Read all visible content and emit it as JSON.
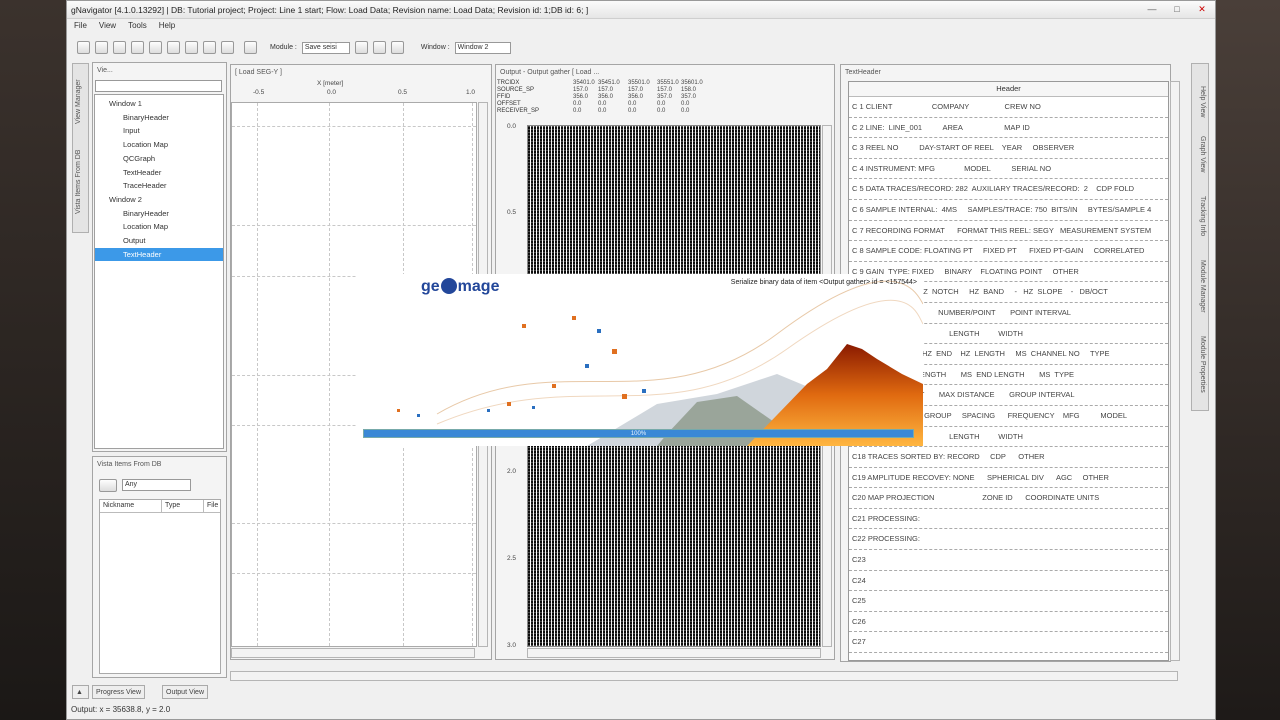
{
  "window": {
    "title": "gNavigator [4.1.0.13292] | DB: Tutorial project; Project: Line 1 start; Flow: Load Data; Revision name: Load Data; Revision id: 1;DB id: 6; ]"
  },
  "menu": [
    "File",
    "View",
    "Tools",
    "Help"
  ],
  "toolbar": {
    "module_label": "Module :",
    "module_value": "Save seisi",
    "window_label": "Window :",
    "window_value": "Window 2"
  },
  "left_panel": {
    "title": "Vie...",
    "tree": [
      {
        "label": "Window 1",
        "level": 0
      },
      {
        "label": "BinaryHeader",
        "level": 1
      },
      {
        "label": "Input",
        "level": 1
      },
      {
        "label": "Location Map",
        "level": 1
      },
      {
        "label": "QCGraph",
        "level": 1
      },
      {
        "label": "TextHeader",
        "level": 1
      },
      {
        "label": "TraceHeader",
        "level": 1
      },
      {
        "label": "Window 2",
        "level": 0
      },
      {
        "label": "BinaryHeader",
        "level": 1
      },
      {
        "label": "Location Map",
        "level": 1
      },
      {
        "label": "Output",
        "level": 1
      },
      {
        "label": "TextHeader",
        "level": 1,
        "selected": true
      }
    ],
    "vista_title": "Vista Items From DB",
    "vista_filter": "Any",
    "vista_columns": [
      "Nickname",
      "Type",
      "File"
    ],
    "side_tabs": [
      "View Manager",
      "Vista Items From DB"
    ]
  },
  "load_panel": {
    "title": "[ Load SEG-Y ]",
    "x_axis_label": "X [meter]",
    "x_ticks": [
      "-0.5",
      "0.0",
      "0.5",
      "1.0"
    ]
  },
  "output_panel": {
    "title": "Output - Output gather [ Load ...",
    "header_names": [
      "TRCIDX",
      "SOURCE_SP",
      "FFID",
      "OFFSET",
      "RECEIVER_SP"
    ],
    "header_cols": [
      [
        "35401.0",
        "157.0",
        "356.0",
        "0.0",
        "0.0"
      ],
      [
        "35451.0",
        "157.0",
        "356.0",
        "0.0",
        "0.0"
      ],
      [
        "35501.0",
        "157.0",
        "356.0",
        "0.0",
        "0.0"
      ],
      [
        "35551.0",
        "157.0",
        "357.0",
        "0.0",
        "0.0"
      ],
      [
        "35601.0",
        "158.0",
        "357.0",
        "0.0",
        "0.0"
      ]
    ],
    "y_ticks": [
      "0.0",
      "0.5",
      "2.0",
      "2.5",
      "3.0"
    ]
  },
  "text_header_panel": {
    "title": "TextHeader",
    "column_header": "Header",
    "rows": [
      "C 1 CLIENT                   COMPANY                 CREW NO",
      "C 2 LINE:  LINE_001          AREA                    MAP ID",
      "C 3 REEL NO          DAY-START OF REEL    YEAR     OBSERVER",
      "C 4 INSTRUMENT: MFG              MODEL          SERIAL NO",
      "C 5 DATA TRACES/RECORD: 282  AUXILIARY TRACES/RECORD:  2    CDP FOLD",
      "C 6 SAMPLE INTERNAL:  4MS     SAMPLES/TRACE: 750  BITS/IN     BYTES/SAMPLE 4",
      "C 7 RECORDING FORMAT      FORMAT THIS REEL: SEGY   MEASUREMENT SYSTEM",
      "C 8 SAMPLE CODE: FLOATING PT     FIXED PT      FIXED PT-GAIN     CORRELATED",
      "C 9 GAIN  TYPE: FIXED     BINARY    FLOATING POINT     OTHER",
      "C10                         HZ  NOTCH     HZ  BAND     -   HZ  SLOPE    -   DB/OCT",
      "C11                                   NUMBER/POINT       POINT INTERVAL",
      "C12                                        LENGTH         WIDTH",
      "C13                           HZ  END    HZ  LENGTH     MS  CHANNEL NO     TYPE",
      "C14                          ENGTH       MS  END LENGTH       MS  TYPE",
      "C15                          T       MAX DISTANCE       GROUP INTERVAL",
      "C16                      ER GROUP     SPACING      FREQUENCY    MFG          MODEL",
      "C17                                        LENGTH         WIDTH",
      "C18 TRACES SORTED BY: RECORD     CDP      OTHER",
      "C19 AMPLITUDE RECOVEY: NONE      SPHERICAL DIV      AGC     OTHER",
      "C20 MAP PROJECTION                       ZONE ID      COORDINATE UNITS",
      "C21 PROCESSING:",
      "C22 PROCESSING:",
      "C23",
      "C24",
      "C25",
      "C26",
      "C27"
    ]
  },
  "right_tabs": [
    "Help View",
    "Graph View",
    "Tracking Info",
    "Module Manager",
    "Module Properties"
  ],
  "splash": {
    "logo": "ge",
    "logo2": "mage",
    "message": "Serialize binary data of item <Output gather> id = <157544>",
    "progress": 100,
    "progress_label": "100%"
  },
  "bottom_tabs": [
    "Progress View",
    "Output View"
  ],
  "status": "Output:   x = 35638.8, y = 2.0"
}
